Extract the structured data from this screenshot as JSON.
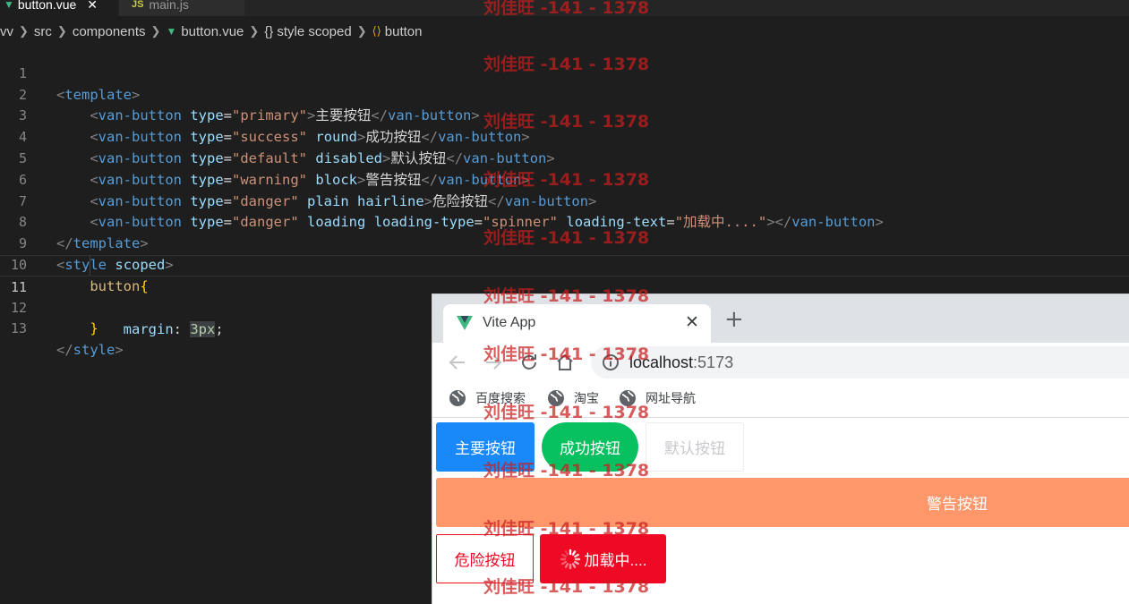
{
  "editor": {
    "tabs": [
      {
        "label": "button.vue",
        "icon": "vue-icon",
        "active": true
      },
      {
        "label": "main.js",
        "icon": "js-icon",
        "active": false
      }
    ],
    "breadcrumb": {
      "root": "vv",
      "folder1": "src",
      "folder2": "components",
      "file": "button.vue",
      "section": "style scoped",
      "element": "button"
    },
    "line_numbers": [
      "1",
      "2",
      "3",
      "4",
      "5",
      "6",
      "7",
      "8",
      "9",
      "10",
      "11",
      "12",
      "13"
    ],
    "code": {
      "template_tag": "template",
      "van_button": "van-button",
      "type_attr": "type",
      "primary_val": "\"primary\"",
      "primary_text": "主要按钮",
      "success_val": "\"success\"",
      "round_attr": "round",
      "success_text": "成功按钮",
      "default_val": "\"default\"",
      "disabled_attr": "disabled",
      "default_text": "默认按钮",
      "warning_val": "\"warning\"",
      "block_attr": "block",
      "warning_text": "警告按钮",
      "danger_val": "\"danger\"",
      "plain_attr": "plain",
      "hairline_attr": "hairline",
      "danger_text": "危险按钮",
      "loading_attr": "loading",
      "loading_type_attr": "loading-type",
      "spinner_val": "\"spinner\"",
      "loading_text_attr": "loading-text",
      "loading_text_val": "\"加载中....\"",
      "style_tag": "style",
      "scoped_attr": "scoped",
      "selector": "button",
      "property": "margin",
      "value_num": "3px"
    }
  },
  "browser": {
    "tab_title": "Vite App",
    "url_host": "localhost",
    "url_port": ":5173",
    "bookmarks": [
      "百度搜索",
      "淘宝",
      "网址导航"
    ]
  },
  "app": {
    "buttons": {
      "primary": "主要按钮",
      "success": "成功按钮",
      "default": "默认按钮",
      "warning": "警告按钮",
      "danger": "危险按钮",
      "loading": "加载中...."
    }
  },
  "watermark": "刘佳旺 -141 - 1378",
  "colors": {
    "primary": "#1989fa",
    "success": "#07c160",
    "warning": "#ff976a",
    "danger": "#ee0a24",
    "vue_green": "#41b883"
  }
}
